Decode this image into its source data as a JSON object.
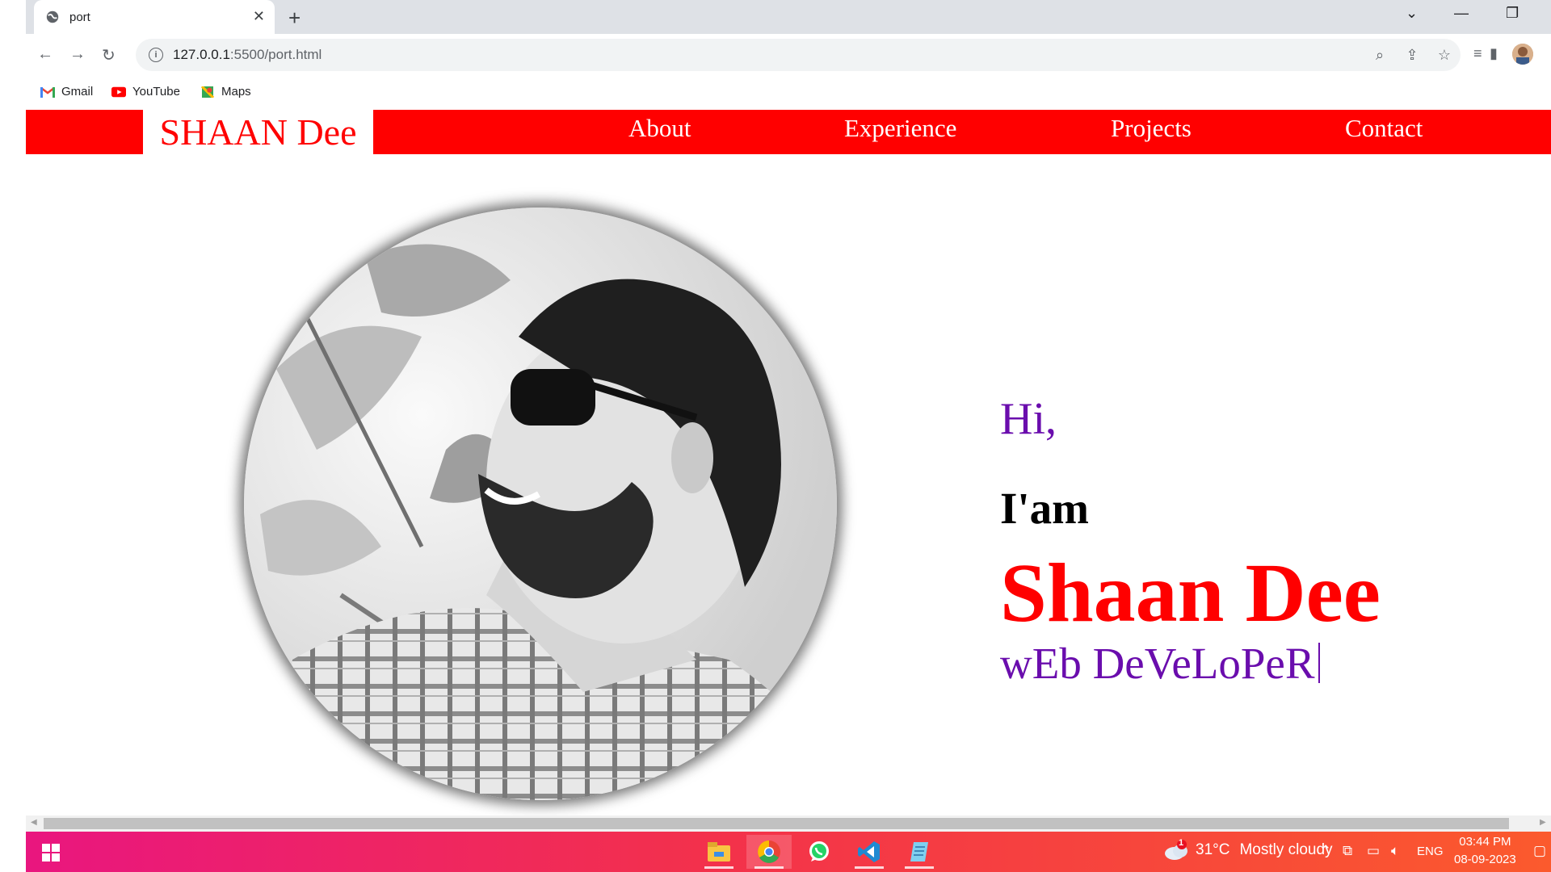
{
  "browser": {
    "tab_title": "port",
    "url_host": "127.0.0.1",
    "url_path": ":5500/port.html",
    "bookmarks": [
      {
        "label": "Gmail",
        "icon": "gmail-icon"
      },
      {
        "label": "YouTube",
        "icon": "youtube-icon"
      },
      {
        "label": "Maps",
        "icon": "maps-icon"
      }
    ]
  },
  "page": {
    "brand": "SHAAN Dee",
    "nav": [
      "About",
      "Experience",
      "Projects",
      "Contact"
    ],
    "hero": {
      "greeting": "Hi,",
      "intro": "I'am",
      "name": "Shaan Dee",
      "role": "wEb DeVeLoPeR"
    },
    "colors": {
      "accent": "#ff0000",
      "greeting": "#6a0dad"
    }
  },
  "taskbar": {
    "weather_temp": "31°C",
    "weather_text": "Mostly cloudy",
    "weather_badge": "1",
    "language": "ENG",
    "time": "03:44 PM",
    "date": "08-09-2023"
  }
}
